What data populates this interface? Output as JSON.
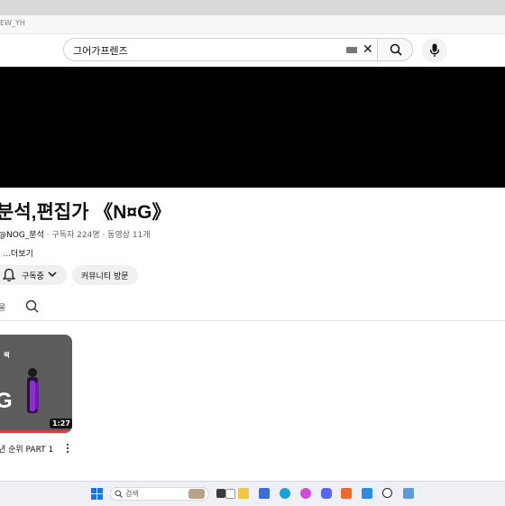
{
  "browser": {
    "bookmark_text": "EW_YH"
  },
  "header": {
    "search_value": "그어가프렌즈"
  },
  "channel": {
    "title": "분석,편집가 《N¤G》",
    "handle": "@NOG_분석",
    "meta_rest": " · 구독자 224명 · 동영상 11개",
    "more_link": "' ...더보기",
    "subscribe_label": "구독중",
    "community_label": "커뮤니티 방문"
  },
  "tabs": {
    "partial_label": "물"
  },
  "video": {
    "thumb_small_text": "랙",
    "thumb_big_text": "G",
    "duration": "1:27",
    "title": "년 순위 PART 1"
  },
  "taskbar": {
    "search_label": "검색"
  },
  "colors": {
    "banner": "#000000",
    "chip_bg": "#f0f0f0",
    "progress_red": "#e03a3a",
    "text_primary": "#0f0f0f",
    "text_secondary": "#606060"
  }
}
